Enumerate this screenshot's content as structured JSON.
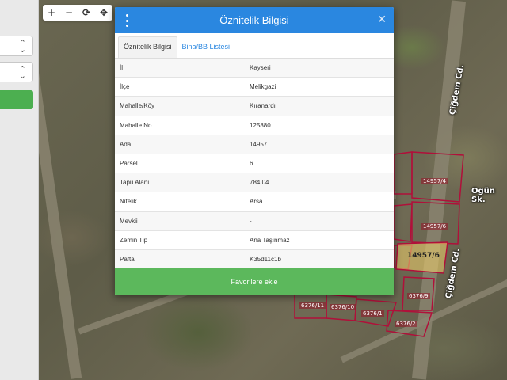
{
  "toolbar": {
    "zoom_in": "+",
    "zoom_out": "−",
    "refresh": "⟳",
    "locate": "✥"
  },
  "map": {
    "street_1": "Çiğdem Cd.",
    "street_2": "Ogün Sk.",
    "street_3": "Çiğdem Cd.",
    "parcels": [
      "14957/4",
      "14957/6",
      "14957/6",
      "6376/11",
      "6376/10",
      "6376/1",
      "6376/9",
      "6376/2"
    ]
  },
  "modal": {
    "title": "Öznitelik Bilgisi",
    "tabs": [
      {
        "label": "Öznitelik Bilgisi",
        "active": true
      },
      {
        "label": "Bina/BB Listesi",
        "active": false
      }
    ],
    "rows": [
      {
        "key": "İl",
        "value": "Kayseri"
      },
      {
        "key": "İlçe",
        "value": "Melikgazi"
      },
      {
        "key": "Mahalle/Köy",
        "value": "Kıranardı"
      },
      {
        "key": "Mahalle No",
        "value": "125880"
      },
      {
        "key": "Ada",
        "value": "14957"
      },
      {
        "key": "Parsel",
        "value": "6"
      },
      {
        "key": "Tapu Alanı",
        "value": "784,04"
      },
      {
        "key": "Nitelik",
        "value": "Arsa"
      },
      {
        "key": "Mevkii",
        "value": "-"
      },
      {
        "key": "Zemin Tip",
        "value": "Ana Taşınmaz"
      },
      {
        "key": "Pafta",
        "value": "K35d11c1b"
      }
    ],
    "favorite_button": "Favorilere ekle"
  },
  "colors": {
    "header": "#2a87e0",
    "button": "#5cb85c",
    "parcel_line": "#b0103a",
    "selected_parcel": "#e8c96a"
  }
}
